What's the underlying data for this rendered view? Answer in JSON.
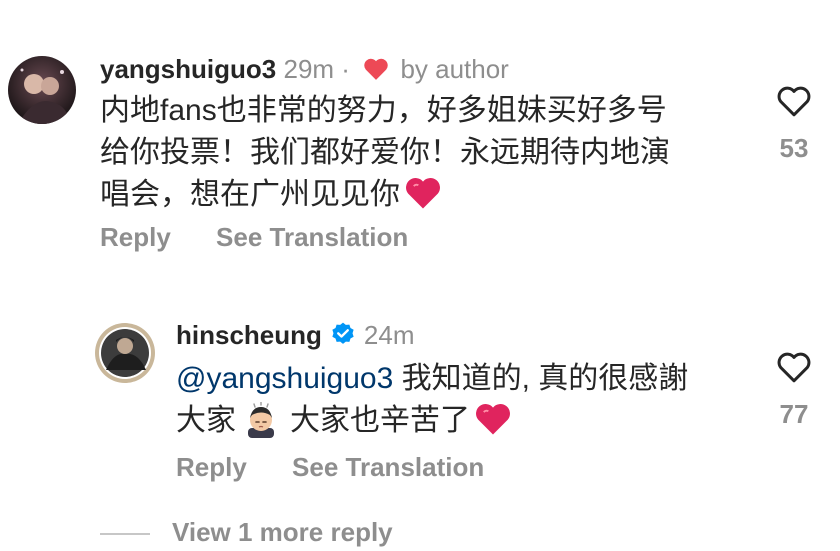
{
  "comment1": {
    "username": "yangshuiguo3",
    "time": "29m",
    "separator": "·",
    "liked_by_author_label": "by author",
    "text_line1": "内地fans也非常的努力，好多姐妹买好多号",
    "text_line2": "给你投票！我们都好爱你！永远期待内地演",
    "text_line3": "唱会，想在广州见见你",
    "like_count": "53",
    "reply_label": "Reply",
    "translate_label": "See Translation"
  },
  "reply1": {
    "username": "hinscheung",
    "time": "24m",
    "mention": "@yangshuiguo3",
    "text_line1_rest": " 我知道的, 真的很感謝",
    "text_line2_a": "大家",
    "text_line2_b": "大家也辛苦了",
    "like_count": "77",
    "reply_label": "Reply",
    "translate_label": "See Translation"
  },
  "view_more_label": "View 1 more reply",
  "colors": {
    "heart_red": "#ed4956",
    "verified_blue": "#0095f6",
    "secondary_text": "#8e8e8e",
    "mention": "#00376b"
  },
  "icons": [
    "heart-outline-icon",
    "verified-badge-icon",
    "red-heart-emoji",
    "face-emoji"
  ]
}
